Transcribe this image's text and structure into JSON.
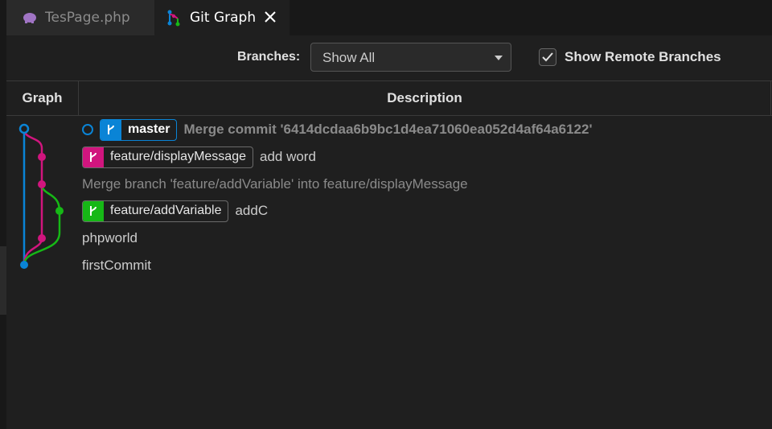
{
  "tabs": [
    {
      "label": "TesPage.php",
      "icon": "php-elephant-icon",
      "active": false
    },
    {
      "label": "Git Graph",
      "icon": "git-graph-icon",
      "active": true
    }
  ],
  "controls": {
    "branches_label": "Branches:",
    "branches_value": "Show All",
    "show_remote_label": "Show Remote Branches",
    "show_remote_checked": true
  },
  "table": {
    "col_graph": "Graph",
    "col_description": "Description"
  },
  "colors": {
    "master": "#0a84d6",
    "feature_display": "#d1157e",
    "feature_add": "#16b816"
  },
  "commits": [
    {
      "ref": "master",
      "message": "Merge commit '6414dcdaa6b9bc1d4ea71060ea052d4af64a6122'"
    },
    {
      "ref": "feature/displayMessage",
      "message": "add word"
    },
    {
      "ref": "",
      "message": "Merge branch 'feature/addVariable' into feature/displayMessage"
    },
    {
      "ref": "feature/addVariable",
      "message": "addC"
    },
    {
      "ref": "",
      "message": "phpworld"
    },
    {
      "ref": "",
      "message": "firstCommit"
    }
  ]
}
